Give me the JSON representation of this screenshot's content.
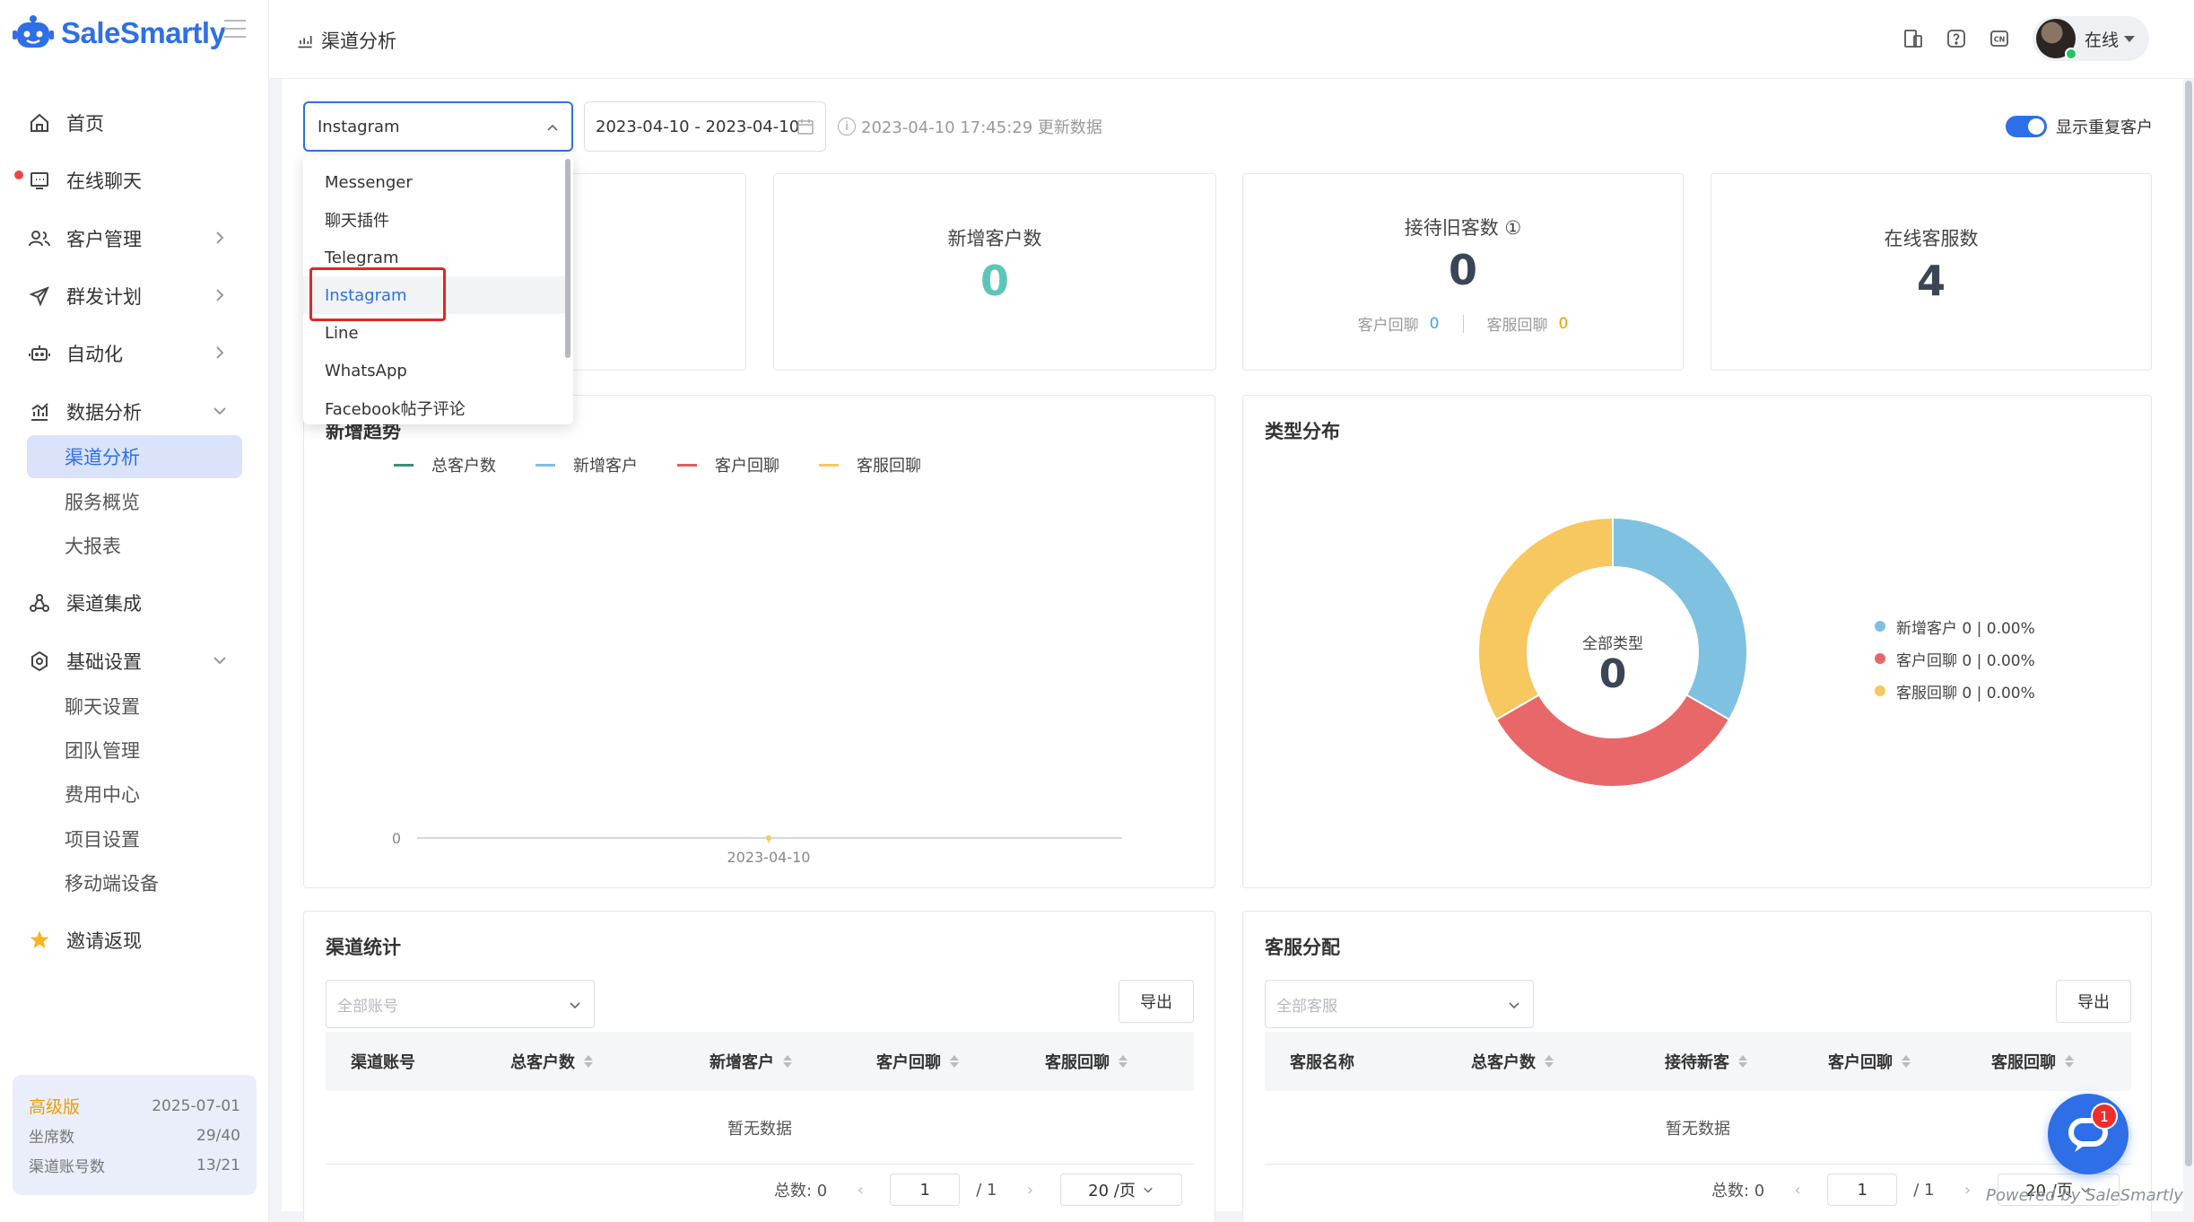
{
  "app": {
    "brand": "SaleSmartly"
  },
  "sidebar": {
    "items": [
      {
        "label": "首页",
        "icon": "home-icon"
      },
      {
        "label": "在线聊天",
        "icon": "chat-icon"
      },
      {
        "label": "客户管理",
        "icon": "users-icon"
      },
      {
        "label": "群发计划",
        "icon": "send-icon"
      },
      {
        "label": "自动化",
        "icon": "robot-icon"
      },
      {
        "label": "数据分析",
        "icon": "chart-icon"
      },
      {
        "label": "渠道集成",
        "icon": "integration-icon"
      },
      {
        "label": "基础设置",
        "icon": "gear-icon"
      },
      {
        "label": "邀请返现",
        "icon": "star-icon"
      }
    ],
    "analytics_sub": [
      "渠道分析",
      "服务概览",
      "大报表"
    ],
    "settings_sub": [
      "聊天设置",
      "团队管理",
      "费用中心",
      "项目设置",
      "移动端设备"
    ],
    "plan": {
      "name": "高级版",
      "expiry": "2025-07-01",
      "seats_label": "坐席数",
      "seats_value": "29/40",
      "channels_label": "渠道账号数",
      "channels_value": "13/21"
    }
  },
  "header": {
    "title": "渠道分析",
    "status": "在线",
    "lang_icon": "CN"
  },
  "filters": {
    "channel_selected": "Instagram",
    "date_range": "2023-04-10 - 2023-04-10",
    "update_info": "2023-04-10 17:45:29 更新数据",
    "toggle_label": "显示重复客户"
  },
  "dropdown": {
    "options": [
      "Messenger",
      "聊天插件",
      "Telegram",
      "Instagram",
      "Line",
      "WhatsApp",
      "Facebook帖子评论"
    ]
  },
  "stats": {
    "new_customers": {
      "label": "新增客户数",
      "value": "0"
    },
    "returning": {
      "label": "接待旧客数 ①",
      "value": "0",
      "customer_reply_label": "客户回聊",
      "customer_reply_value": "0",
      "agent_reply_label": "客服回聊",
      "agent_reply_value": "0"
    },
    "online_agents": {
      "label": "在线客服数",
      "value": "4"
    }
  },
  "trend": {
    "title": "新增趋势",
    "legend": [
      "总客户数",
      "新增客户",
      "客户回聊",
      "客服回聊"
    ],
    "colors": [
      "#3a8f7a",
      "#7ec1e0",
      "#e85a5a",
      "#f6c85f"
    ],
    "y_tick": "0",
    "x_tick": "2023-04-10"
  },
  "distribution": {
    "title": "类型分布",
    "center_label": "全部类型",
    "center_value": "0",
    "legend": [
      "新增客户 0 | 0.00%",
      "客户回聊 0 | 0.00%",
      "客服回聊 0 | 0.00%"
    ]
  },
  "chart_data": [
    {
      "type": "line",
      "title": "新增趋势",
      "categories": [
        "2023-04-10"
      ],
      "series": [
        {
          "name": "总客户数",
          "values": [
            0
          ]
        },
        {
          "name": "新增客户",
          "values": [
            0
          ]
        },
        {
          "name": "客户回聊",
          "values": [
            0
          ]
        },
        {
          "name": "客服回聊",
          "values": [
            0
          ]
        }
      ]
    },
    {
      "type": "pie",
      "title": "类型分布",
      "categories": [
        "新增客户",
        "客户回聊",
        "客服回聊"
      ],
      "values": [
        0,
        0,
        0
      ],
      "colors": [
        "#7ec1e0",
        "#e8686a",
        "#f6c85f"
      ]
    }
  ],
  "channel_stats": {
    "title": "渠道统计",
    "filter_placeholder": "全部账号",
    "export": "导出",
    "columns": [
      "渠道账号",
      "总客户数",
      "新增客户",
      "客户回聊",
      "客服回聊"
    ],
    "empty": "暂无数据",
    "total_label": "总数: 0",
    "page": "1",
    "page_total": "/ 1",
    "page_size": "20 /页"
  },
  "agent_dist": {
    "title": "客服分配",
    "filter_placeholder": "全部客服",
    "export": "导出",
    "columns": [
      "客服名称",
      "总客户数",
      "接待新客",
      "客户回聊",
      "客服回聊"
    ],
    "empty": "暂无数据",
    "total_label": "总数: 0",
    "page": "1",
    "page_total": "/ 1",
    "page_size": "20 /页"
  },
  "chat_widget": {
    "badge": "1",
    "powered": "Powered by SaleSmartly"
  }
}
